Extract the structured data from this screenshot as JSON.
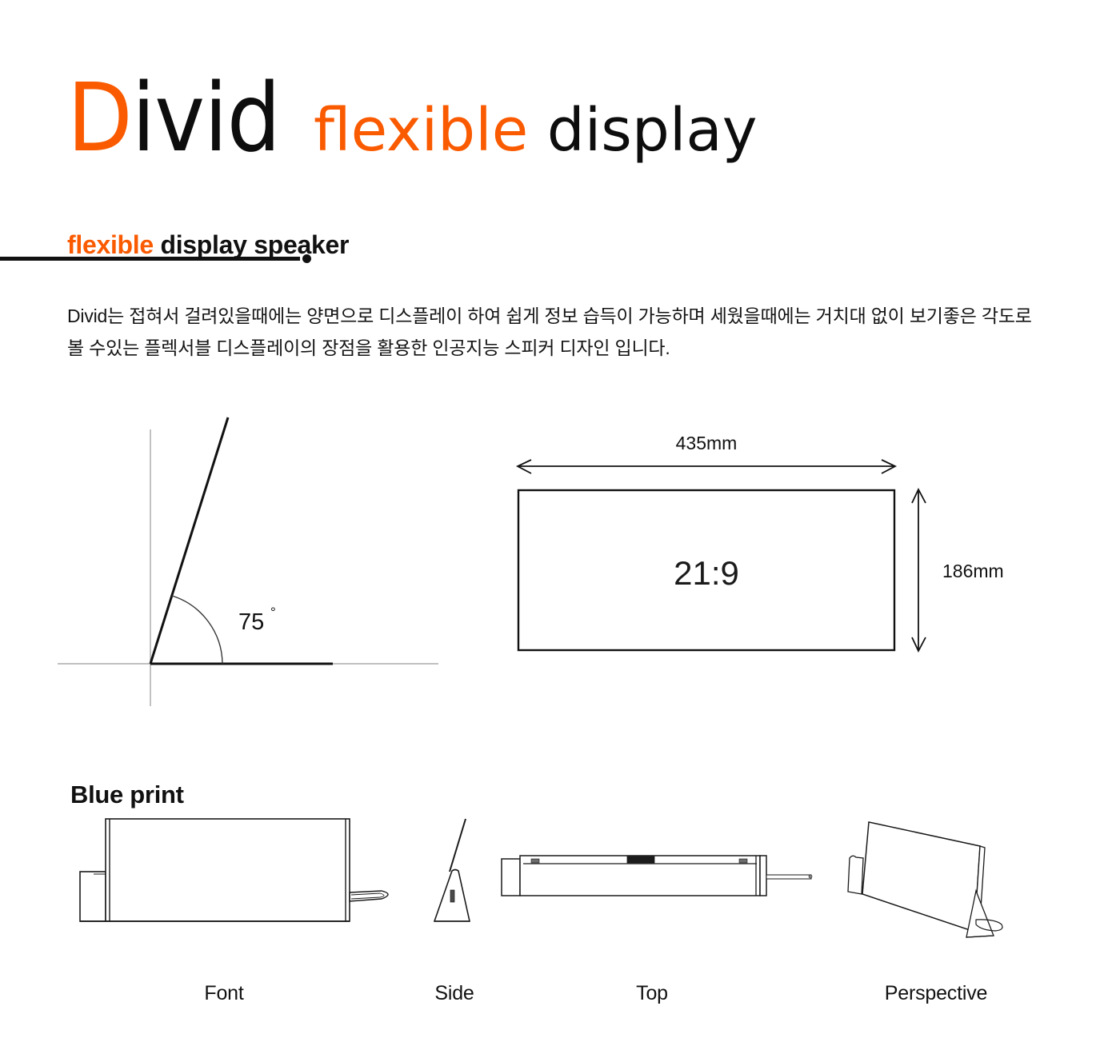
{
  "logo": {
    "brand_first": "D",
    "brand_rest": "ivid",
    "tagline_first": "flexible",
    "tagline_rest": "display",
    "accent_color": "#fa5a00",
    "text_color": "#111111"
  },
  "intro": {
    "heading_accent": "flexible",
    "heading_rest": " display speaker",
    "paragraph": "Divid는 접혀서 걸려있을때에는 양면으로 디스플레이 하여 쉽게 정보 습득이 가능하며 세웠을때에는 거치대 없이 보기좋은 각도로 볼 수있는 플렉서블 디스플레이의 장점을 활용한 인공지능 스피커 디자인 입니다."
  },
  "angle_diagram": {
    "angle_value": "75",
    "degree_symbol": "°"
  },
  "dimension_diagram": {
    "width_label": "435mm",
    "height_label": "186mm",
    "aspect_ratio": "21:9"
  },
  "blueprint": {
    "heading": "Blue print",
    "views": [
      {
        "id": "front",
        "label": "Font"
      },
      {
        "id": "side",
        "label": "Side"
      },
      {
        "id": "top",
        "label": "Top"
      },
      {
        "id": "perspective",
        "label": "Perspective"
      }
    ]
  }
}
